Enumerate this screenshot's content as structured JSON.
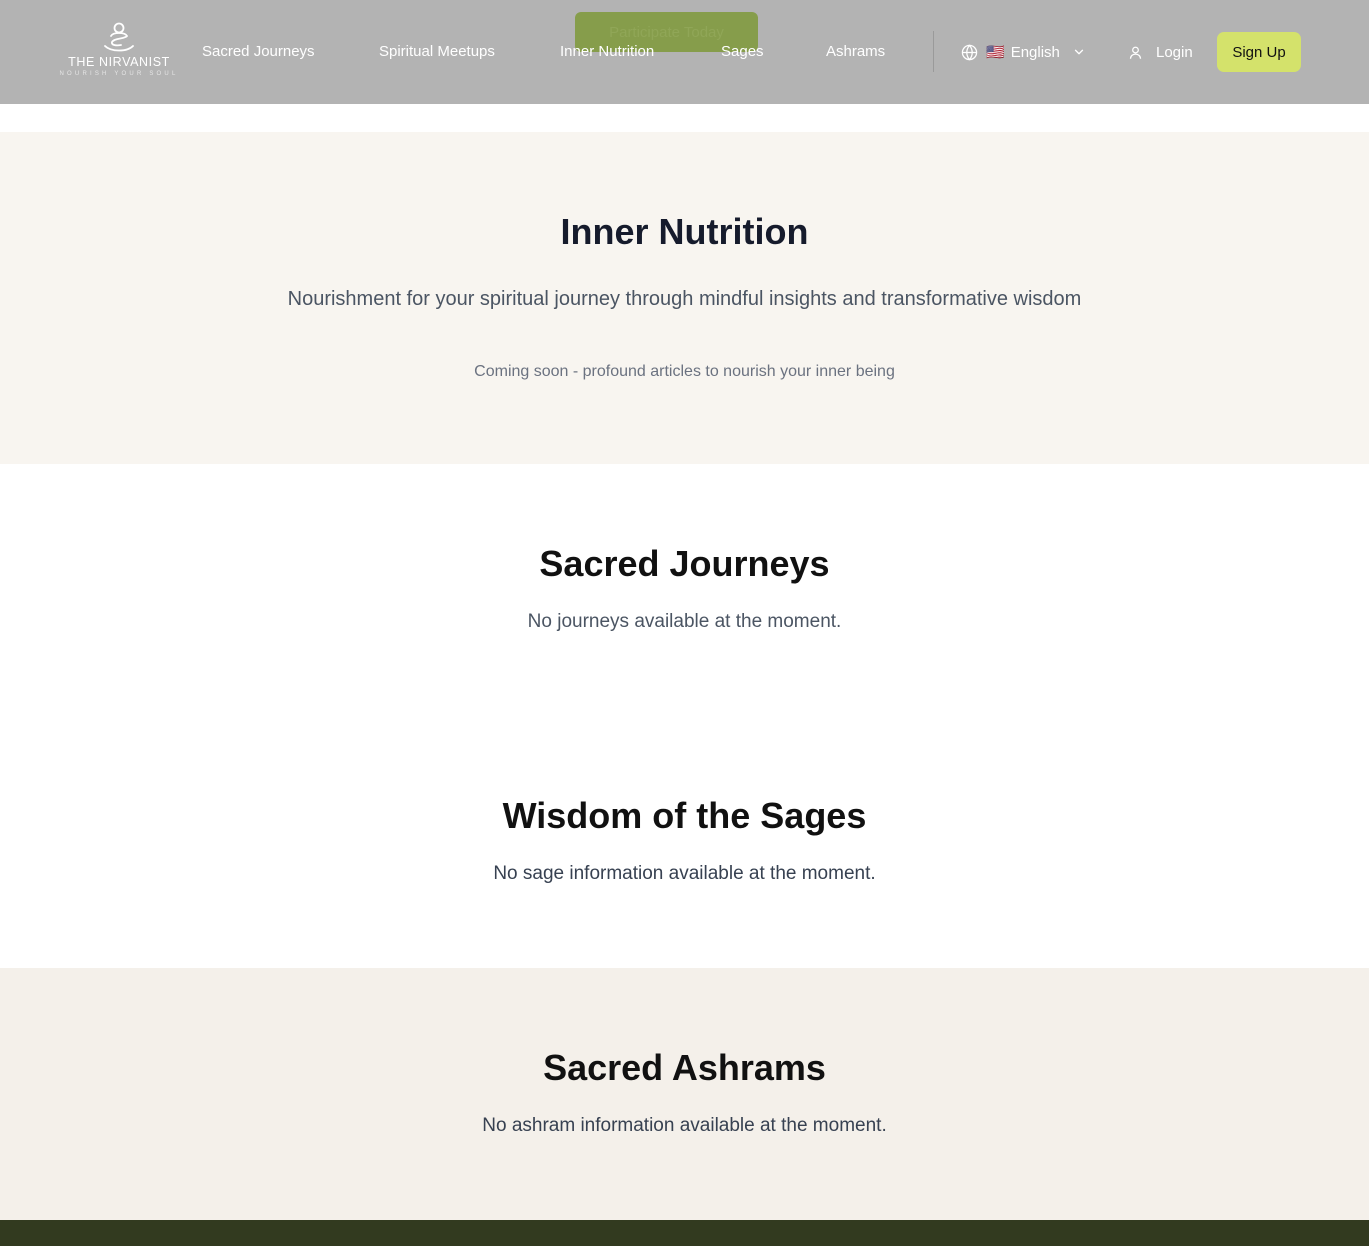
{
  "header": {
    "ghost_button_label": "Participate Today",
    "logo": {
      "title": "THE NIRVANIST",
      "tagline": "NOURISH YOUR SOUL"
    },
    "nav": [
      {
        "label": "Sacred Journeys"
      },
      {
        "label": "Spiritual Meetups"
      },
      {
        "label": "Inner Nutrition"
      },
      {
        "label": "Sages"
      },
      {
        "label": "Ashrams"
      }
    ],
    "language": {
      "flag": "🇺🇸",
      "label": "English"
    },
    "login_label": "Login",
    "signup_label": "Sign Up"
  },
  "inner_nutrition": {
    "title": "Inner Nutrition",
    "subtitle": "Nourishment for your spiritual journey through mindful insights and transformative wisdom",
    "coming_soon": "Coming soon - profound articles to nourish your inner being"
  },
  "sacred_journeys": {
    "title": "Sacred Journeys",
    "message": "No journeys available at the moment."
  },
  "sages": {
    "title": "Wisdom of the Sages",
    "message": "No sage information available at the moment."
  },
  "ashrams": {
    "title": "Sacred Ashrams",
    "message": "No ashram information available at the moment."
  },
  "colors": {
    "header_bg": "#b3b3b3",
    "signup_bg": "#d4e26b",
    "nutrition_bg": "#f8f5f0",
    "ashrams_bg": "#f4f0ea",
    "footer_bg": "#323a1f"
  }
}
